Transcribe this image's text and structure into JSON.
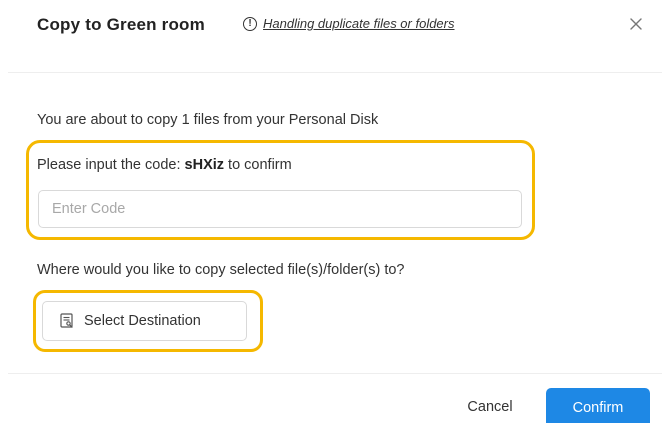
{
  "dialog": {
    "title": "Copy to Green room",
    "help_icon": "info-circle-icon",
    "help_link": "Handling duplicate files or folders",
    "close_icon": "close-icon"
  },
  "body": {
    "message": "You are about to copy 1 files from your Personal Disk",
    "code_prompt_prefix": "Please input the code: ",
    "code": "sHXiz",
    "code_prompt_suffix": " to confirm",
    "code_placeholder": "Enter Code",
    "code_value": "",
    "destination_prompt": "Where would you like to copy selected file(s)/folder(s) to?",
    "destination_icon": "folder-select-icon",
    "destination_button": "Select Destination"
  },
  "footer": {
    "cancel_label": "Cancel",
    "confirm_label": "Confirm"
  },
  "colors": {
    "primary": "#1e88e5",
    "highlight": "#f5b800",
    "text": "#333333",
    "placeholder": "#a8a8a8",
    "border": "#d9d9d9"
  }
}
